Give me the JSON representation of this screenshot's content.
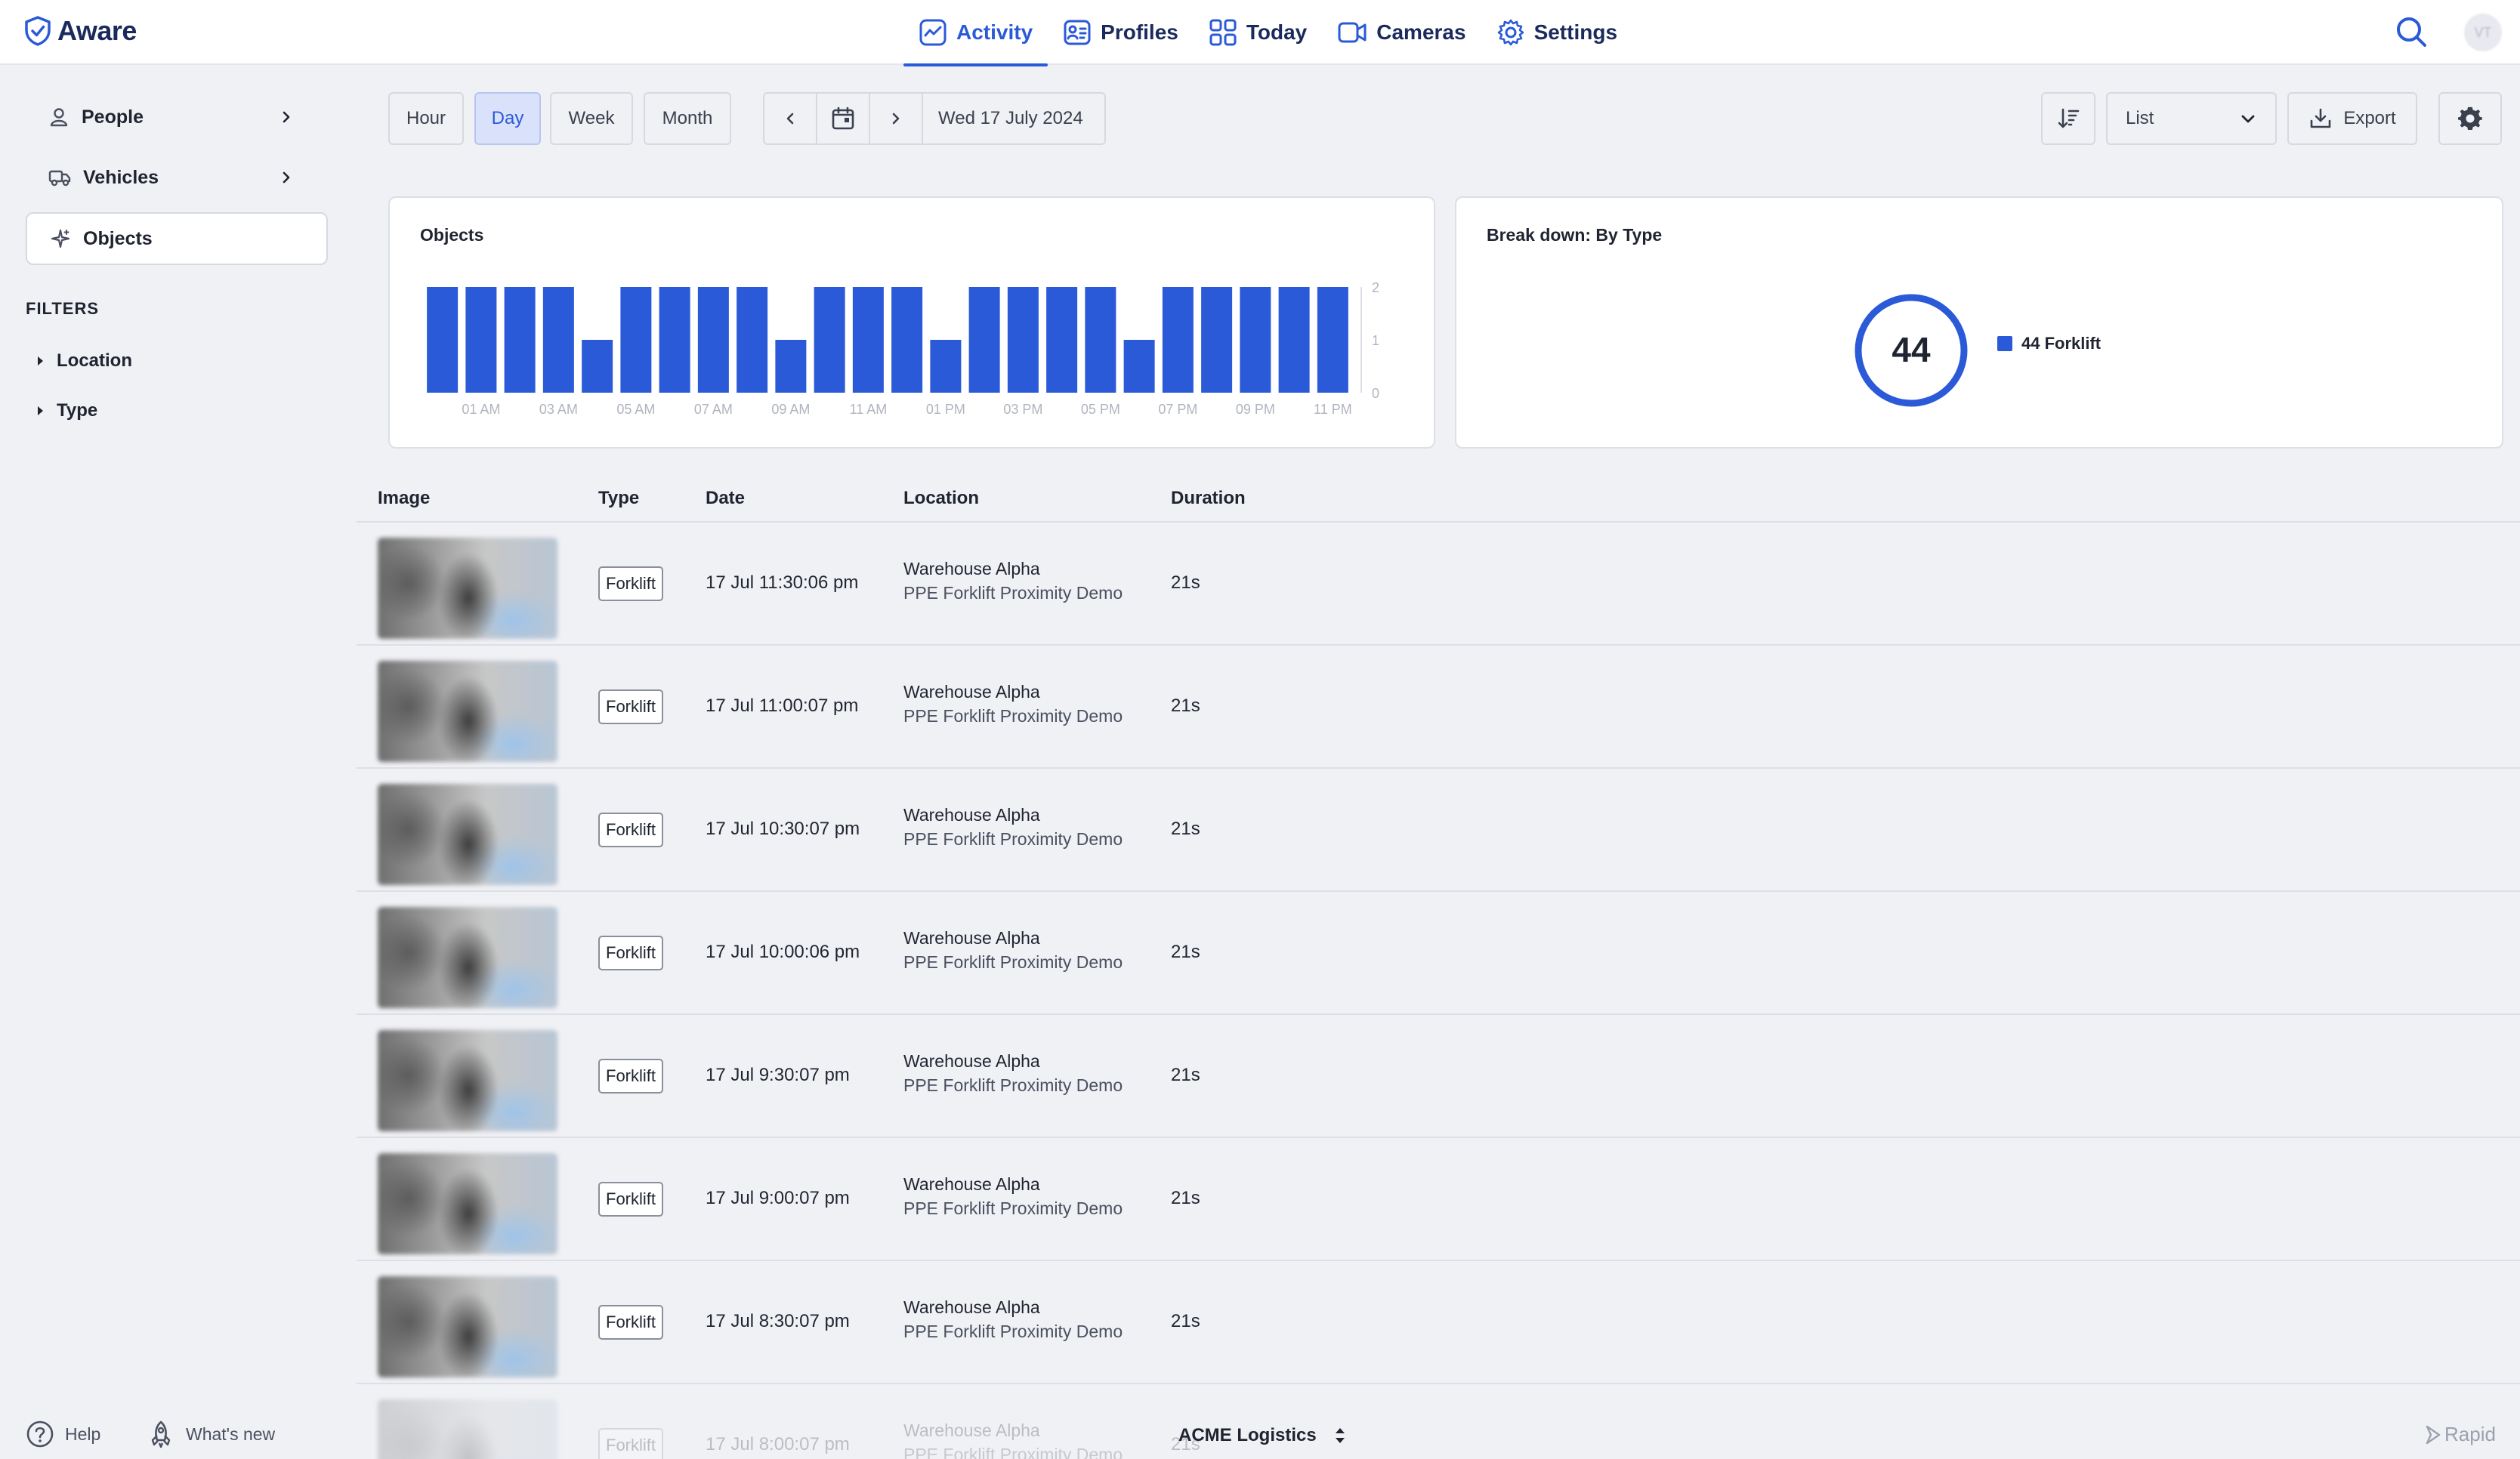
{
  "app": {
    "name": "Aware"
  },
  "nav": {
    "items": [
      {
        "label": "Activity",
        "icon": "activity-icon",
        "active": true
      },
      {
        "label": "Profiles",
        "icon": "profiles-icon"
      },
      {
        "label": "Today",
        "icon": "grid-icon"
      },
      {
        "label": "Cameras",
        "icon": "camera-icon"
      },
      {
        "label": "Settings",
        "icon": "gear-icon"
      }
    ],
    "avatar_initials": "VT"
  },
  "sidebar": {
    "items": [
      {
        "label": "People",
        "icon": "person-icon"
      },
      {
        "label": "Vehicles",
        "icon": "truck-icon"
      },
      {
        "label": "Objects",
        "icon": "sparkle-icon",
        "selected": true
      }
    ],
    "filters_title": "FILTERS",
    "filters": [
      {
        "label": "Location"
      },
      {
        "label": "Type"
      }
    ],
    "footer": {
      "help": "Help",
      "whats_new": "What's new"
    }
  },
  "toolbar": {
    "periods": [
      "Hour",
      "Day",
      "Week",
      "Month"
    ],
    "active_period": "Day",
    "date_label": "Wed 17 July 2024",
    "view_select": "List",
    "export_label": "Export"
  },
  "objects_card": {
    "title": "Objects"
  },
  "chart_data": {
    "type": "bar",
    "title": "Objects",
    "categories": [
      "12 AM",
      "01 AM",
      "02 AM",
      "03 AM",
      "04 AM",
      "05 AM",
      "06 AM",
      "07 AM",
      "08 AM",
      "09 AM",
      "10 AM",
      "11 AM",
      "12 PM",
      "01 PM",
      "02 PM",
      "03 PM",
      "04 PM",
      "05 PM",
      "06 PM",
      "07 PM",
      "08 PM",
      "09 PM",
      "10 PM",
      "11 PM"
    ],
    "x_tick_labels": [
      "01 AM",
      "03 AM",
      "05 AM",
      "07 AM",
      "09 AM",
      "11 AM",
      "01 PM",
      "03 PM",
      "05 PM",
      "07 PM",
      "09 PM",
      "11 PM"
    ],
    "values": [
      2,
      2,
      2,
      2,
      1,
      2,
      2,
      2,
      2,
      1,
      2,
      2,
      2,
      1,
      2,
      2,
      2,
      2,
      1,
      2,
      2,
      2,
      2,
      2
    ],
    "ylim": [
      0,
      2
    ],
    "y_ticks": [
      "0",
      "1",
      "2"
    ],
    "color": "#2b5ad8"
  },
  "breakdown": {
    "title": "Break down: By Type",
    "total": "44",
    "legend": [
      {
        "label": "44 Forklift",
        "color": "#2b5ad8"
      }
    ]
  },
  "table": {
    "headers": [
      "Image",
      "Type",
      "Date",
      "Location",
      "Duration"
    ],
    "rows": [
      {
        "type": "Forklift",
        "date": "17 Jul 11:30:06 pm",
        "location": "Warehouse Alpha",
        "camera": "PPE Forklift Proximity Demo",
        "duration": "21s"
      },
      {
        "type": "Forklift",
        "date": "17 Jul 11:00:07 pm",
        "location": "Warehouse Alpha",
        "camera": "PPE Forklift Proximity Demo",
        "duration": "21s"
      },
      {
        "type": "Forklift",
        "date": "17 Jul 10:30:07 pm",
        "location": "Warehouse Alpha",
        "camera": "PPE Forklift Proximity Demo",
        "duration": "21s"
      },
      {
        "type": "Forklift",
        "date": "17 Jul 10:00:06 pm",
        "location": "Warehouse Alpha",
        "camera": "PPE Forklift Proximity Demo",
        "duration": "21s"
      },
      {
        "type": "Forklift",
        "date": "17 Jul 9:30:07 pm",
        "location": "Warehouse Alpha",
        "camera": "PPE Forklift Proximity Demo",
        "duration": "21s"
      },
      {
        "type": "Forklift",
        "date": "17 Jul 9:00:07 pm",
        "location": "Warehouse Alpha",
        "camera": "PPE Forklift Proximity Demo",
        "duration": "21s"
      },
      {
        "type": "Forklift",
        "date": "17 Jul 8:30:07 pm",
        "location": "Warehouse Alpha",
        "camera": "PPE Forklift Proximity Demo",
        "duration": "21s"
      },
      {
        "type": "Forklift",
        "date": "17 Jul 8:00:07 pm",
        "location": "Warehouse Alpha",
        "camera": "PPE Forklift Proximity Demo",
        "duration": "21s"
      }
    ]
  },
  "org": {
    "name": "ACME Logistics"
  },
  "brand_footer": {
    "label": "Rapid"
  }
}
